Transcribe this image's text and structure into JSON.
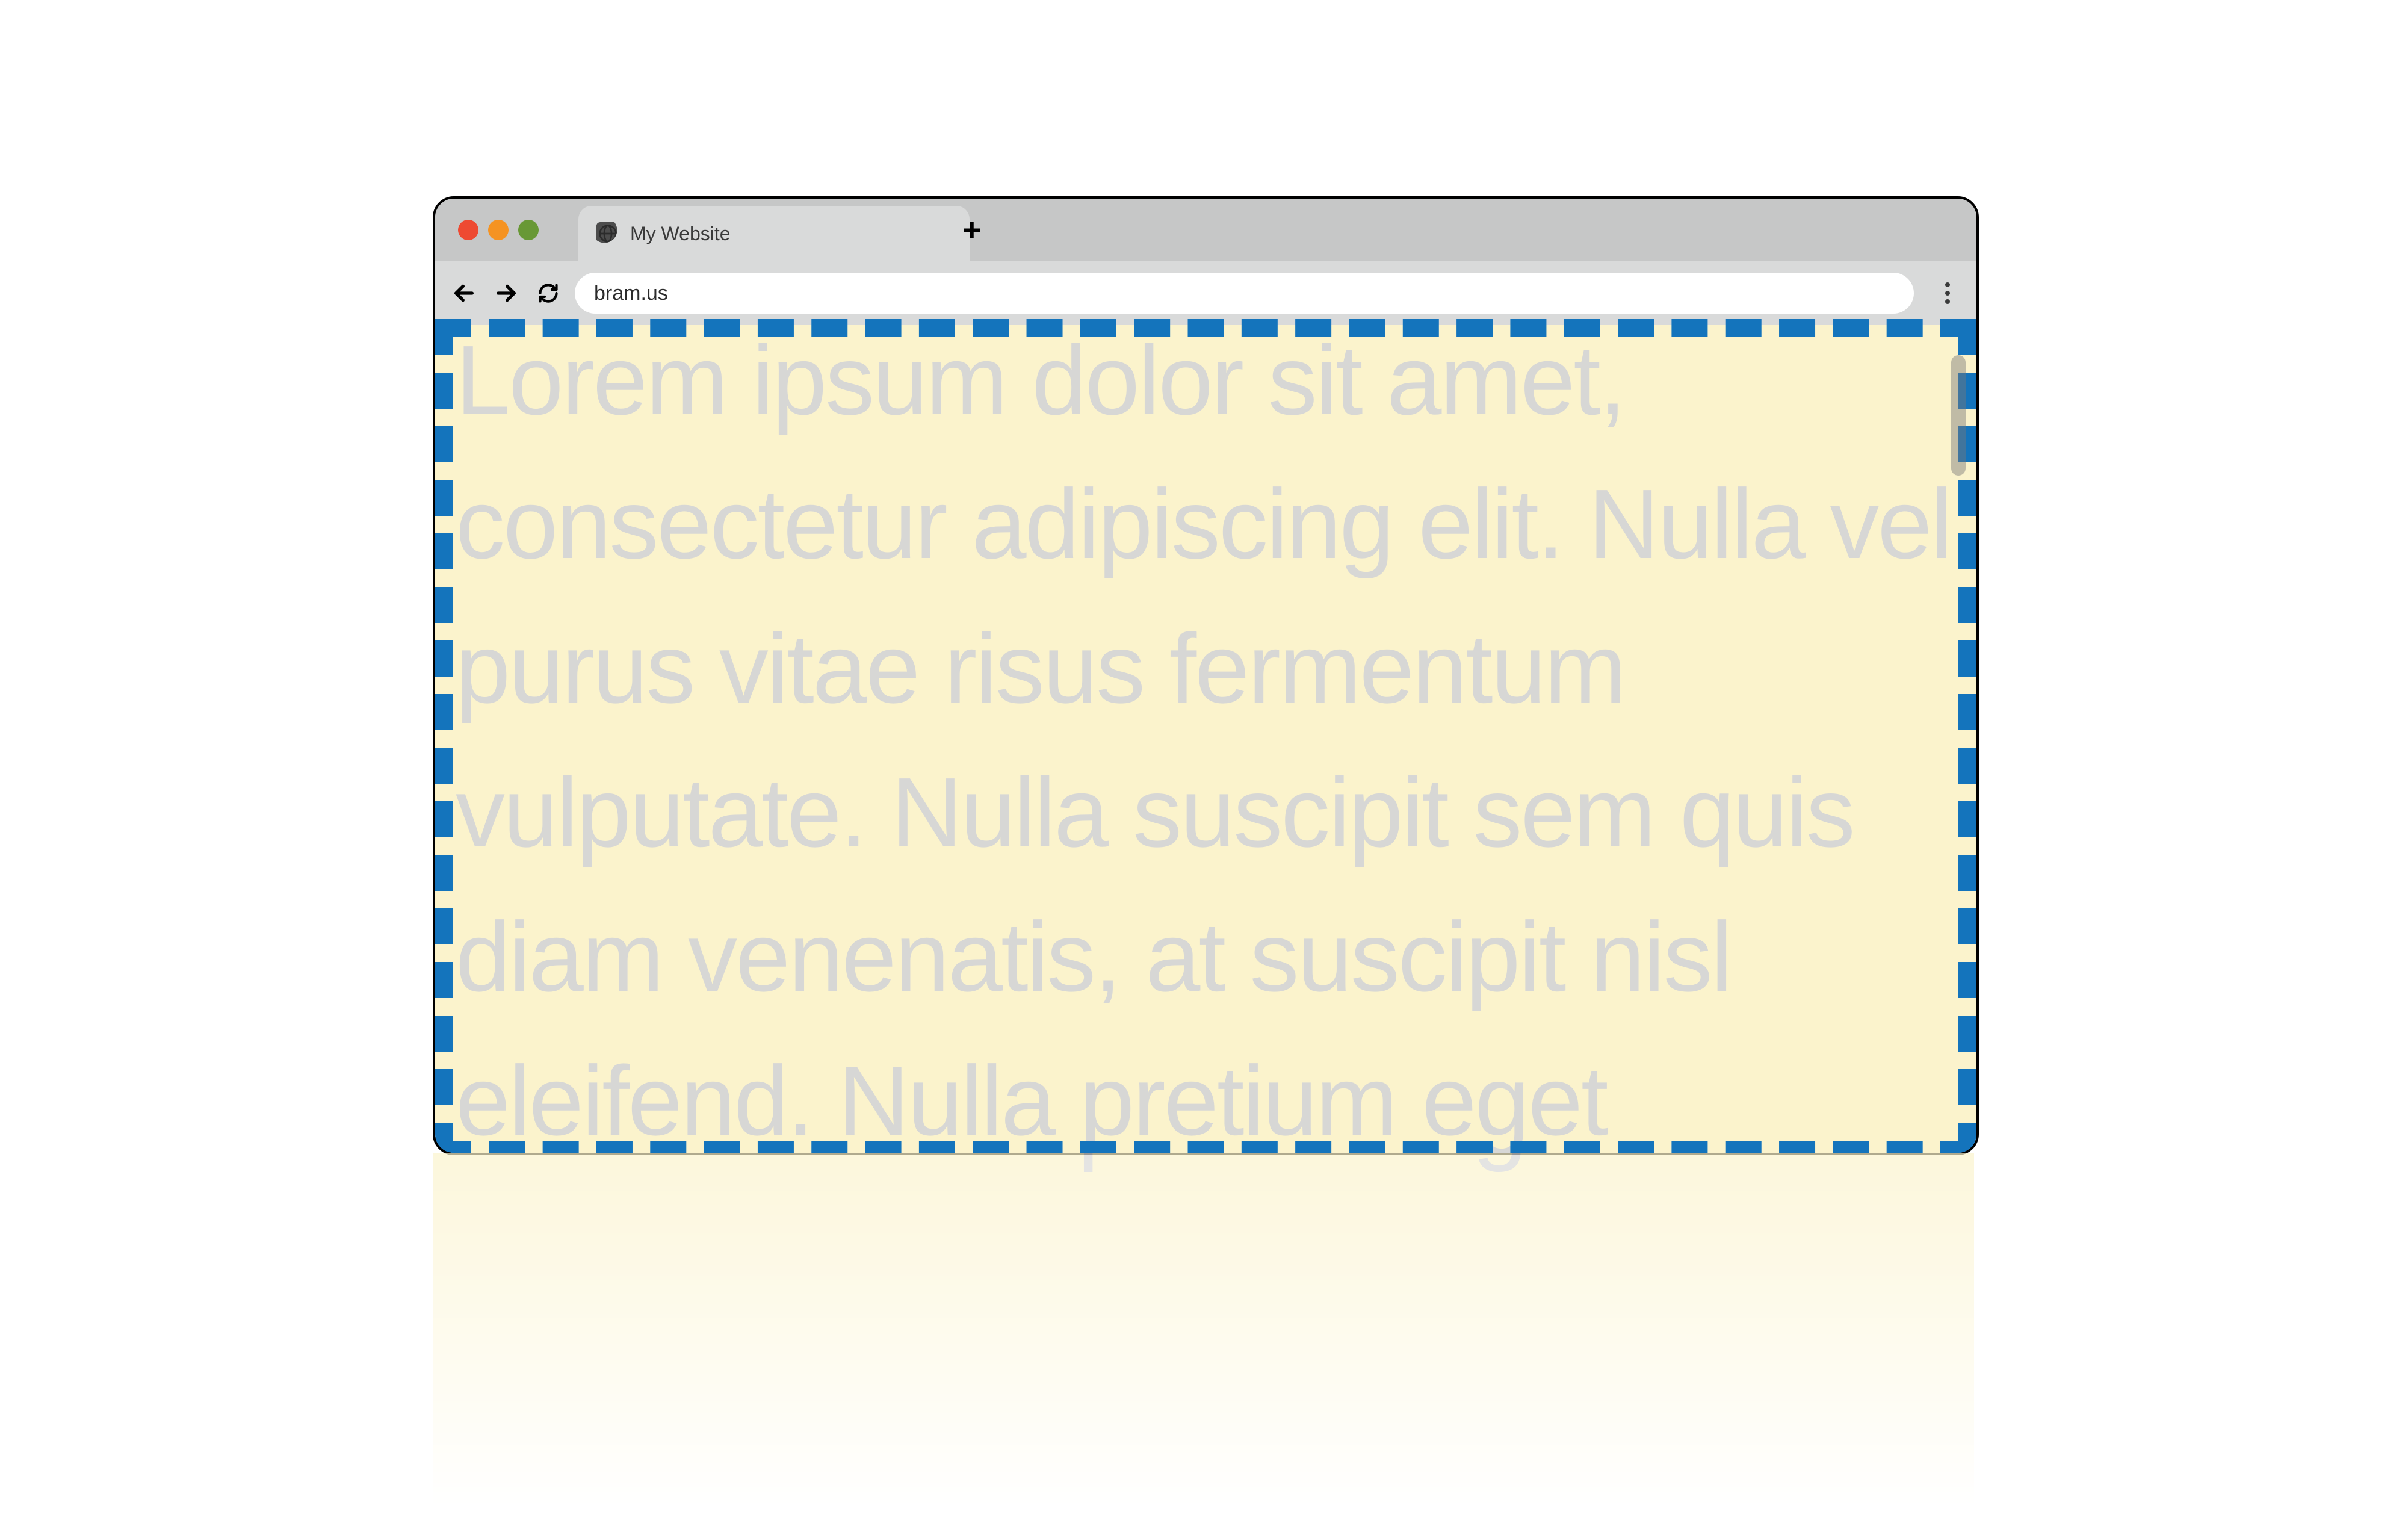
{
  "window": {
    "tab_title": "My Website",
    "address": "bram.us",
    "newtab_label": "+"
  },
  "nav": {
    "back": "←",
    "forward": "→",
    "reload": "⟳"
  },
  "colors": {
    "viewport_bg": "#fbf3cc",
    "dashed_border": "#1474bc",
    "text": "#d7d7d5"
  },
  "page": {
    "body_text": "Lorem ipsum dolor sit amet, consectetur adipiscing elit. Nulla vel purus vitae risus fermentum vulputate. Nulla suscipit sem quis diam venenatis, at suscipit nisl eleifend. Nulla pretium eget"
  }
}
